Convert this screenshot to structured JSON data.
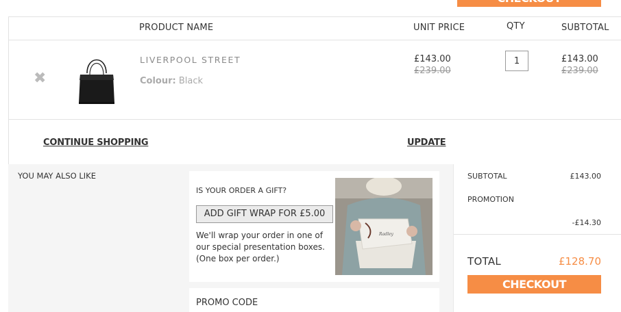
{
  "top_checkout_label": "CHECKOUT",
  "table": {
    "headers": {
      "product_name": "PRODUCT NAME",
      "unit_price": "UNIT PRICE",
      "qty": "QTY",
      "subtotal": "SUBTOTAL"
    },
    "items": [
      {
        "name": "LIVERPOOL STREET",
        "colour_label": "Colour:",
        "colour_value": "Black",
        "unit_price": "£143.00",
        "unit_price_was": "£239.00",
        "qty": "1",
        "subtotal": "£143.00",
        "subtotal_was": "£239.00"
      }
    ],
    "continue_shopping": "CONTINUE SHOPPING",
    "update": "UPDATE"
  },
  "you_may_also_like": "YOU MAY ALSO LIKE",
  "gift": {
    "question": "IS YOUR ORDER A GIFT?",
    "button": "ADD GIFT WRAP FOR £5.00",
    "description": "We'll wrap your order in one of our special presentation boxes. (One box per order.)"
  },
  "promo": {
    "label": "PROMO CODE"
  },
  "summary": {
    "subtotal_label": "SUBTOTAL",
    "subtotal_value": "£143.00",
    "promotion_label": "PROMOTION",
    "promotion_value": "-£14.30",
    "total_label": "TOTAL",
    "total_value": "£128.70",
    "checkout_label": "CHECKOUT"
  },
  "colors": {
    "accent": "#f68d45"
  },
  "icons": {
    "remove": "close-icon"
  }
}
